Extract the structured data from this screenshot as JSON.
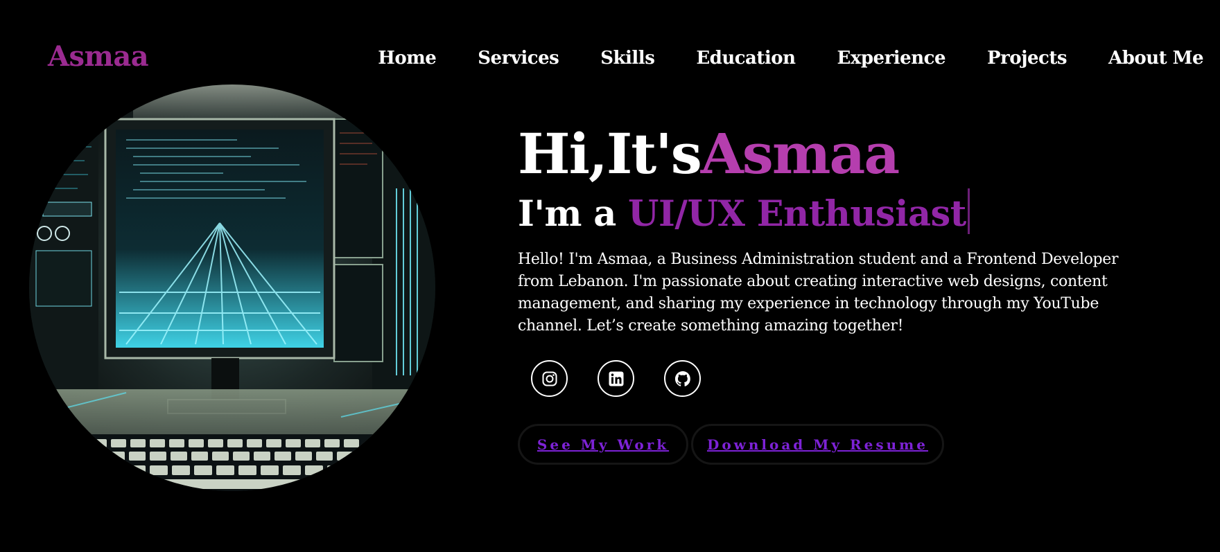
{
  "header": {
    "logo": "Asmaa",
    "nav": [
      "Home",
      "Services",
      "Skills",
      "Education",
      "Experience",
      "Projects",
      "About Me"
    ]
  },
  "hero": {
    "greeting_prefix": "Hi,It's",
    "greeting_name": "Asmaa",
    "role_prefix": "I'm a ",
    "role_typed": "UI/UX Enthusiast",
    "bio": "Hello! I'm Asmaa, a Business Administration student and a Frontend Developer from Lebanon. I'm passionate about creating interactive web designs, content management, and sharing my experience in technology through my YouTube channel. Let’s create something amazing together!",
    "image_icon": "computer-workstation-illustration"
  },
  "socials": [
    {
      "name": "instagram",
      "icon": "instagram-icon"
    },
    {
      "name": "linkedin",
      "icon": "linkedin-icon"
    },
    {
      "name": "github",
      "icon": "github-icon"
    }
  ],
  "buttons": {
    "work": "See My Work",
    "resume": "Download My Resume"
  },
  "colors": {
    "background": "#000000",
    "logo": "#9b2b91",
    "name_accent": "#b53eae",
    "role_accent": "#9126a6",
    "button_text": "#7d22d6"
  }
}
